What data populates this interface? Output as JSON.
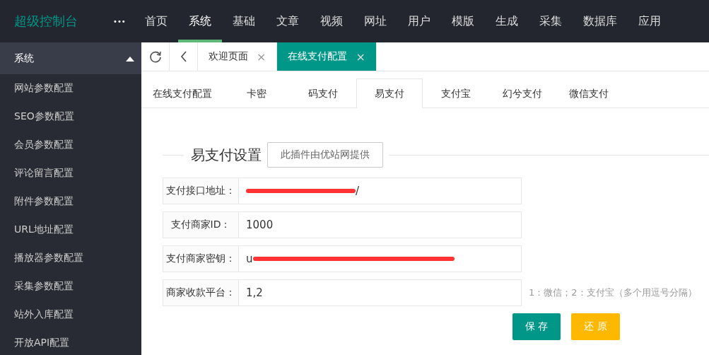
{
  "brand": "超级控制台",
  "more": "•••",
  "nav": [
    {
      "label": "首页",
      "selected": false
    },
    {
      "label": "系统",
      "selected": true
    },
    {
      "label": "基础",
      "selected": false
    },
    {
      "label": "文章",
      "selected": false
    },
    {
      "label": "视频",
      "selected": false
    },
    {
      "label": "网址",
      "selected": false
    },
    {
      "label": "用户",
      "selected": false
    },
    {
      "label": "模版",
      "selected": false
    },
    {
      "label": "生成",
      "selected": false
    },
    {
      "label": "采集",
      "selected": false
    },
    {
      "label": "数据库",
      "selected": false
    },
    {
      "label": "应用",
      "selected": false
    }
  ],
  "sidebar": {
    "title": "系统",
    "expanded": true,
    "items": [
      "网站参数配置",
      "SEO参数配置",
      "会员参数配置",
      "评论留言配置",
      "附件参数配置",
      "URL地址配置",
      "播放器参数配置",
      "采集参数配置",
      "站外入库配置",
      "开放API配置"
    ]
  },
  "page_tabs": [
    {
      "label": "欢迎页面",
      "selected": false,
      "close": "×"
    },
    {
      "label": "在线支付配置",
      "selected": true,
      "close": "×"
    }
  ],
  "sub_tabs": [
    {
      "label": "在线支付配置",
      "selected": false
    },
    {
      "label": "卡密",
      "selected": false
    },
    {
      "label": "码支付",
      "selected": false
    },
    {
      "label": "易支付",
      "selected": true
    },
    {
      "label": "支付宝",
      "selected": false
    },
    {
      "label": "幻兮支付",
      "selected": false
    },
    {
      "label": "微信支付",
      "selected": false
    }
  ],
  "section": {
    "title": "易支付设置",
    "note": "此插件由优站网提供"
  },
  "fields": [
    {
      "label": "支付接口地址：",
      "value": "/",
      "redacted": true,
      "kind": "tail"
    },
    {
      "label": "支付商家ID：",
      "value": "1000",
      "redacted": false
    },
    {
      "label": "支付商家密钥：",
      "value": "u",
      "redacted": true,
      "kind": "head"
    },
    {
      "label": "商家收款平台：",
      "value": "1,2",
      "redacted": false,
      "hint": "1：微信；2：支付宝（多个用逗号分隔）"
    }
  ],
  "buttons": [
    {
      "label": "保 存",
      "kind": "primary"
    },
    {
      "label": "还 原",
      "kind": "warning"
    }
  ]
}
